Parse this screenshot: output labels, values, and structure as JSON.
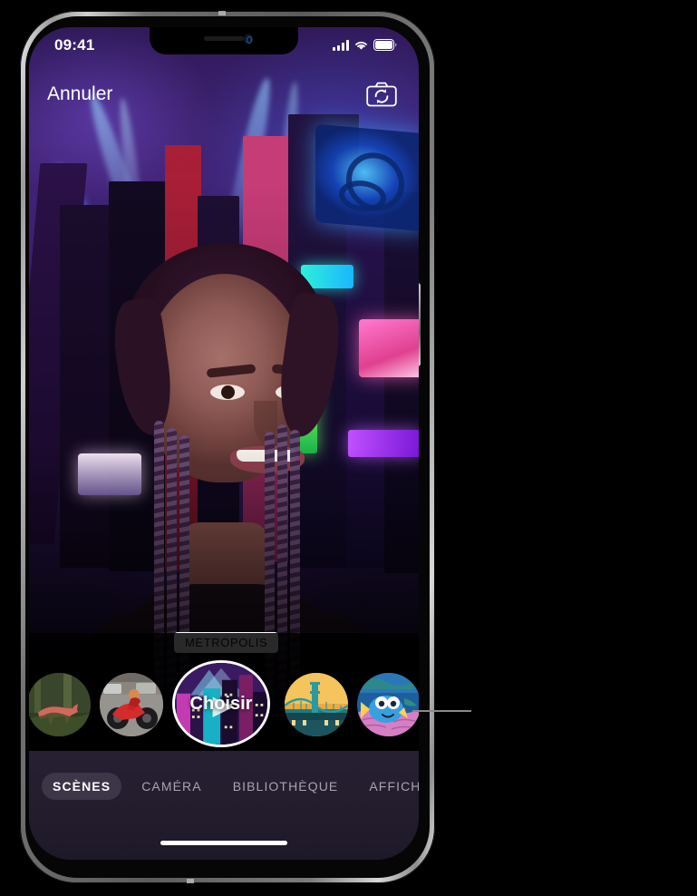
{
  "status_bar": {
    "time": "09:41",
    "signal_icon": "cellular-signal-icon",
    "wifi_icon": "wifi-icon",
    "battery_icon": "battery-icon"
  },
  "nav_bar": {
    "cancel_label": "Annuler",
    "flip_camera_icon": "camera-flip-icon"
  },
  "viewfinder": {
    "scene_name": "METROPOLIS",
    "subject": "person-portrait"
  },
  "carousel": {
    "choose_label": "Choisir",
    "items": [
      {
        "name": "fox-forest-scene",
        "alt": "Renard dans la forêt"
      },
      {
        "name": "motorcycle-street-scene",
        "alt": "Moto rouge dans la rue"
      },
      {
        "name": "metropolis-scene",
        "alt": "Metropolis",
        "selected": true
      },
      {
        "name": "bridge-sunset-scene",
        "alt": "Pont au coucher du soleil"
      },
      {
        "name": "underwater-fish-scene",
        "alt": "Poisson bleu sous l'eau"
      }
    ]
  },
  "tab_bar": {
    "tabs": [
      {
        "label": "SCÈNES",
        "active": true
      },
      {
        "label": "CAMÉRA",
        "active": false
      },
      {
        "label": "BIBLIOTHÈQUE",
        "active": false
      },
      {
        "label": "AFFICHES",
        "active": false
      }
    ],
    "home_indicator": "home-indicator"
  },
  "colors": {
    "accent_white": "#ffffff",
    "tabbar_bg": "#221c2c",
    "active_tab_bg": "#3d3548",
    "inactive_tab_text": "#a9a3b3",
    "scene_label_bg": "#ffffff",
    "scene_label_text": "#1a1a1a",
    "callout_line": "#8a8a8a"
  }
}
